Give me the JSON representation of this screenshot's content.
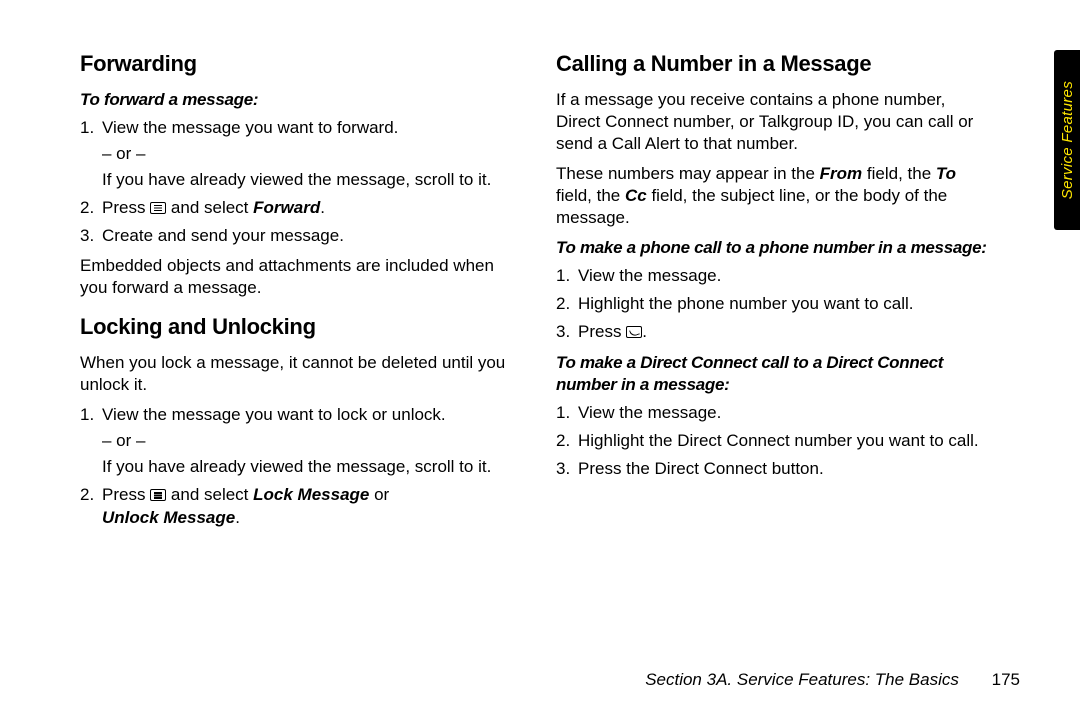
{
  "tab_label": "Service Features",
  "footer": {
    "section": "Section 3A. Service Features: The Basics",
    "page": "175"
  },
  "left": {
    "h_fwd": "Forwarding",
    "sub_fwd": "To forward a message:",
    "fwd1": "View the message you want to forward.",
    "or": "– or –",
    "fwd1b": "If you have already viewed the message, scroll to it.",
    "fwd2_a": "Press ",
    "fwd2_b": " and select ",
    "fwd2_c": "Forward",
    "fwd2_d": ".",
    "fwd3": "Create and send your message.",
    "fwd_note": "Embedded objects and attachments are included when you forward a message.",
    "h_lock": "Locking and Unlocking",
    "lock_intro": "When you lock a message, it cannot be deleted until you unlock it.",
    "lock1": "View the message you want to lock or unlock.",
    "lock1b": "If you have already viewed the message, scroll to it.",
    "lock2_a": "Press ",
    "lock2_b": " and select ",
    "lock2_c": "Lock Message",
    "lock2_d": " or ",
    "lock2_e": "Unlock Message",
    "lock2_f": "."
  },
  "right": {
    "h_call": "Calling a Number in a Message",
    "p1": "If a message you receive contains a phone number, Direct Connect number, or Talkgroup ID, you can call or send a Call Alert to that number.",
    "p2_a": "These numbers may appear in the ",
    "p2_from": "From",
    "p2_b": " field, the ",
    "p2_to": "To",
    "p2_c": " field, the ",
    "p2_cc": "Cc",
    "p2_d": " field, the subject line, or the body of the message.",
    "sub_phone": "To make a phone call to a phone number in a message:",
    "ph1": "View the message.",
    "ph2": "Highlight the phone number you want to call.",
    "ph3_a": "Press ",
    "ph3_b": ".",
    "sub_dc": "To make a Direct Connect call to a Direct Connect number in a message:",
    "dc1": "View the message.",
    "dc2": "Highlight the Direct Connect number you want to call.",
    "dc3": "Press the Direct Connect button."
  },
  "nums": {
    "n1": "1.",
    "n2": "2.",
    "n3": "3."
  }
}
